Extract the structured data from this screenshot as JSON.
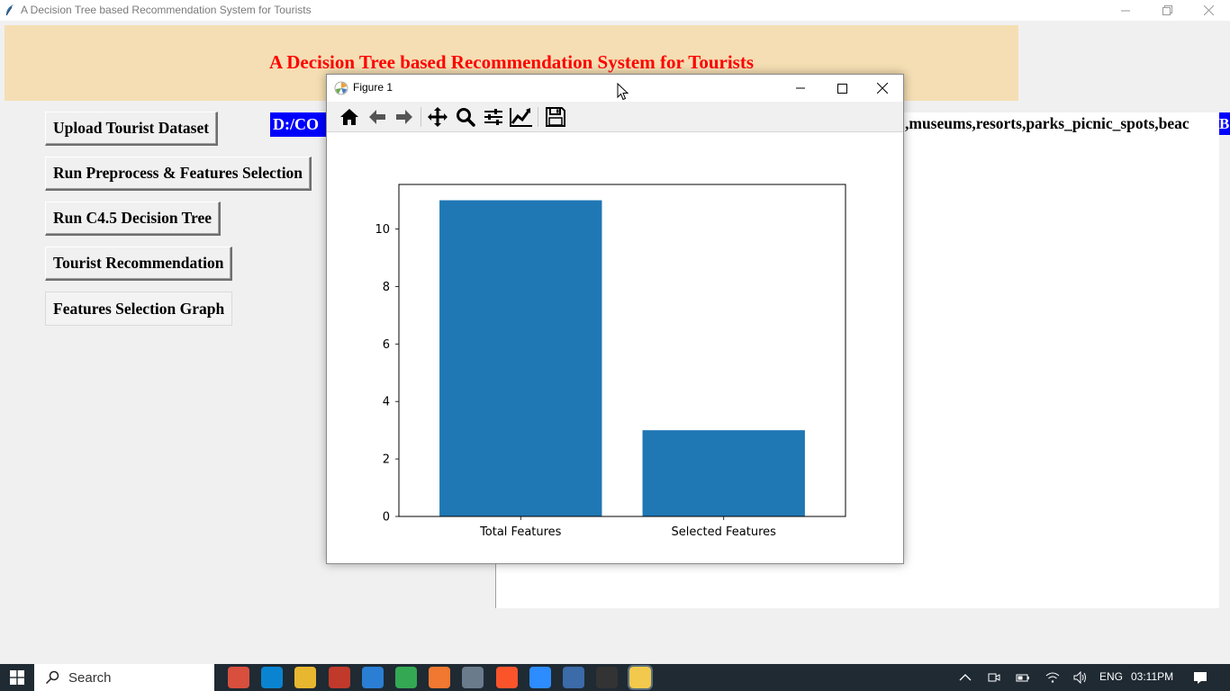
{
  "window": {
    "title": "A Decision Tree based Recommendation System for Tourists"
  },
  "header": {
    "title": "A Decision Tree based Recommendation System for Tourists",
    "background": "#f5deb3",
    "title_color": "#ff0000"
  },
  "buttons": {
    "upload": "Upload Tourist Dataset",
    "preprocess": "Run Preprocess & Features Selection",
    "c45": "Run C4.5 Decision Tree",
    "recommend": "Tourist Recommendation",
    "graph": "Features Selection Graph"
  },
  "path_label": "D:/CO",
  "output_text": ",museums,resorts,parks_picnic_spots,beac",
  "output_tail": "B",
  "figure": {
    "title": "Figure 1",
    "toolbar": [
      "home-icon",
      "back-icon",
      "forward-icon",
      "pan-icon",
      "zoom-icon",
      "configure-icon",
      "edit-axis-icon",
      "save-icon"
    ]
  },
  "chart_data": {
    "type": "bar",
    "categories": [
      "Total Features",
      "Selected Features"
    ],
    "values": [
      11,
      3
    ],
    "title": "",
    "xlabel": "",
    "ylabel": "",
    "ylim": [
      0,
      11.55
    ],
    "yticks": [
      0,
      2,
      4,
      6,
      8,
      10
    ],
    "bar_color": "#1f77b4",
    "grid": false
  },
  "taskbar": {
    "search_text": "Search",
    "language": "ENG",
    "time": "03:11PM",
    "colors": [
      "#d94f3d",
      "#0a84d0",
      "#e8b730",
      "#c0392b",
      "#2a7fd4",
      "#34a853",
      "#f07830",
      "#6a7b8c",
      "#fb542b",
      "#2d8cff",
      "#3b6ba8",
      "#333333",
      "#f2c94c"
    ]
  }
}
